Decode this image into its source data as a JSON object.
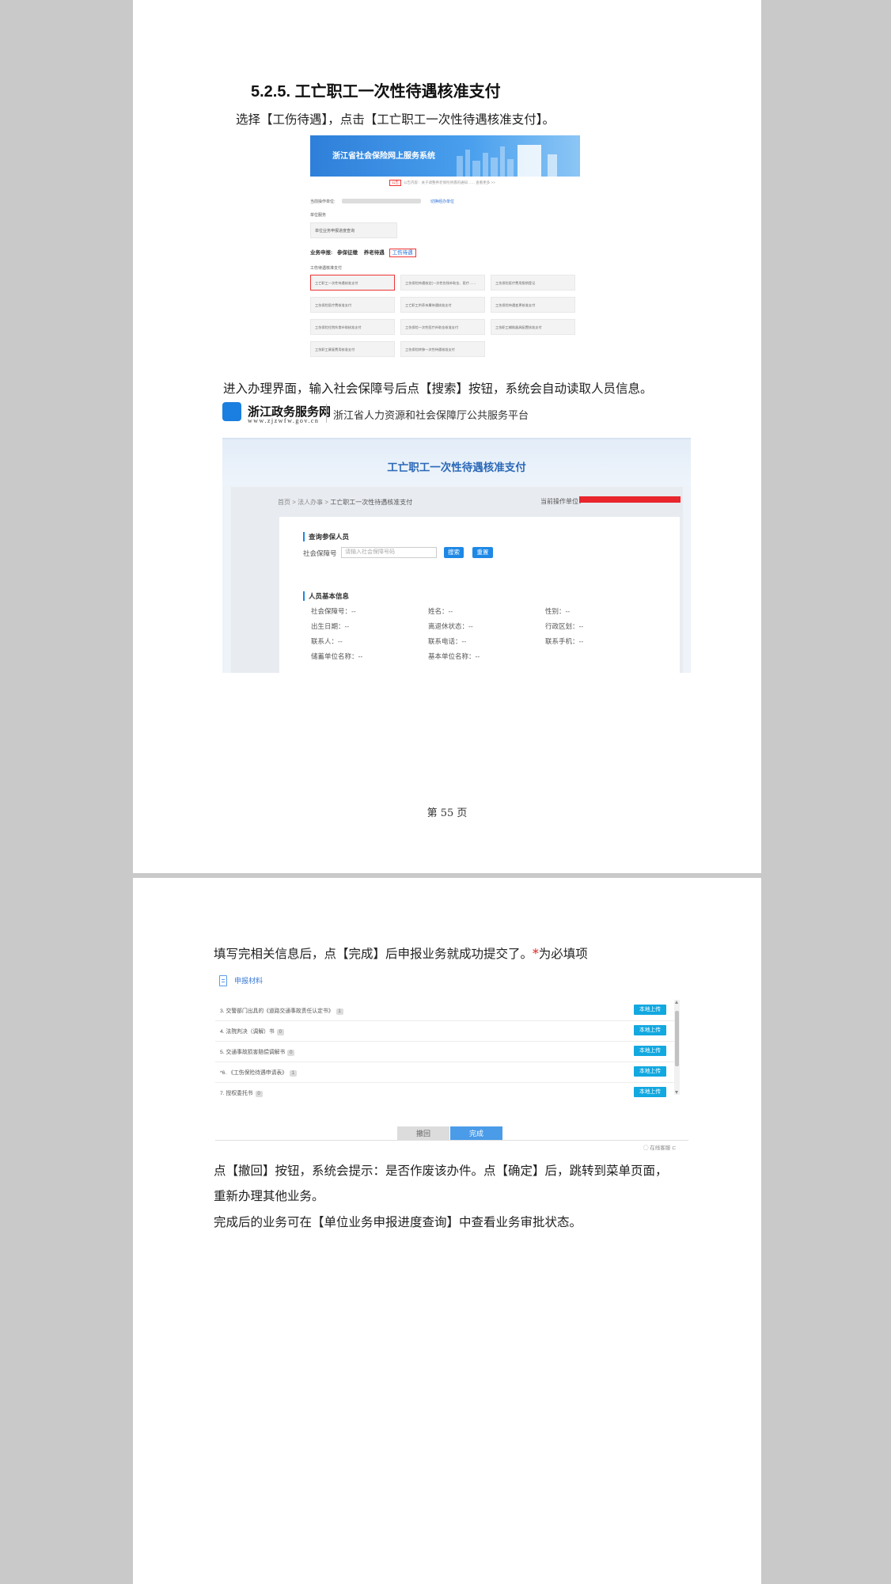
{
  "page1": {
    "heading": "5.2.5.  工亡职工一次性待遇核准支付",
    "para1": "选择【工伤待遇】，点击【工亡职工一次性待遇核准支付】。",
    "fig1": {
      "banner_title": "浙江省社会保险网上服务系统",
      "notice_tag": "公告",
      "notice_text": "公告内容：关于调整养老保险待遇的通知……   查看更多 >>",
      "unit_label": "当前操作单位:",
      "switch_unit": "切换经办单位",
      "cat_label": "单位服务",
      "cat_select": "单位业务申报进度查询",
      "bar_label": "业务申报:",
      "bar_items": [
        "参保征缴",
        "养老待遇"
      ],
      "bar_active": "工伤待遇",
      "section": "工伤待遇核准支付",
      "cards": [
        "工亡职工一次性待遇核准支付",
        "工伤保险待遇核定(一次性伤残补助金、医疗……",
        "工伤保险医疗费用报销登记",
        "工伤保险医疗费核准支付",
        "工亡职工供养亲属待遇核准支付",
        "工伤保险待遇变更核准支付",
        "工伤保险住院伙食补助核准支付",
        "工伤保险一次性医疗补助金核准支付",
        "工伤职工辅助器具配置核准支付",
        "工伤职工康复费用核准支付",
        "工伤保险转移一次性待遇核准支付"
      ]
    },
    "para2": "进入办理界面，输入社会保障号后点【搜索】按钮，系统会自动读取人员信息。",
    "fig2": {
      "logo_name": "浙江政务服务网",
      "logo_url": "www.zjzwfw.gov.cn",
      "logo_sub": "浙江省人力资源和社会保障厅公共服务平台",
      "title": "工亡职工一次性待遇核准支付",
      "crumbs": [
        "首页",
        "法人办事",
        "工亡职工一次性待遇核准支付"
      ],
      "op_unit": "当前操作单位：",
      "query_title": "查询参保人员",
      "ssn_label": "社会保障号",
      "ssn_placeholder": "请输入社会保障号码",
      "search": "搜索",
      "reset": "重置",
      "basic_title": "人员基本信息",
      "fields": [
        "社会保障号：--",
        "姓名：--",
        "性别：--",
        "出生日期：--",
        "离退休状态：--",
        "行政区划：--",
        "联系人：--",
        "联系电话：--",
        "联系手机：--",
        "储蓄单位名称：--",
        "基本单位名称：--"
      ]
    },
    "page_no": "第  55  页"
  },
  "page2": {
    "para1_main": "填写完相关信息后，点【完成】后申报业务就成功提交了。",
    "para1_star": "*",
    "para1_tail": "为必填项",
    "fig3": {
      "header": "申报材料",
      "rows": [
        {
          "label": "3. 交警部门出具的《道路交通事故责任认定书》",
          "q": "1"
        },
        {
          "label": "4. 法院判决（调解）书",
          "q": "0"
        },
        {
          "label": "5. 交通事故损害赔偿调解书",
          "q": "0"
        },
        {
          "label": "*6. 《工伤保险待遇申请表》",
          "q": "1"
        },
        {
          "label": "7. 授权委托书",
          "q": "0"
        }
      ],
      "upload": "本地上传",
      "back": "撤回",
      "done": "完成",
      "online": "◯ 在线客服   ⊏"
    },
    "para2a": "点【撤回】按钮，系统会提示：是否作废该办件。点【确定】后，跳转到菜单页面，",
    "para2b": "重新办理其他业务。",
    "para3": " 完成后的业务可在【单位业务申报进度查询】中查看业务审批状态。"
  },
  "colors": {
    "accent_blue": "#1e88e5",
    "upload_blue": "#12a8e0",
    "highlight_red": "#e33333",
    "title_blue": "#2b68b7"
  }
}
